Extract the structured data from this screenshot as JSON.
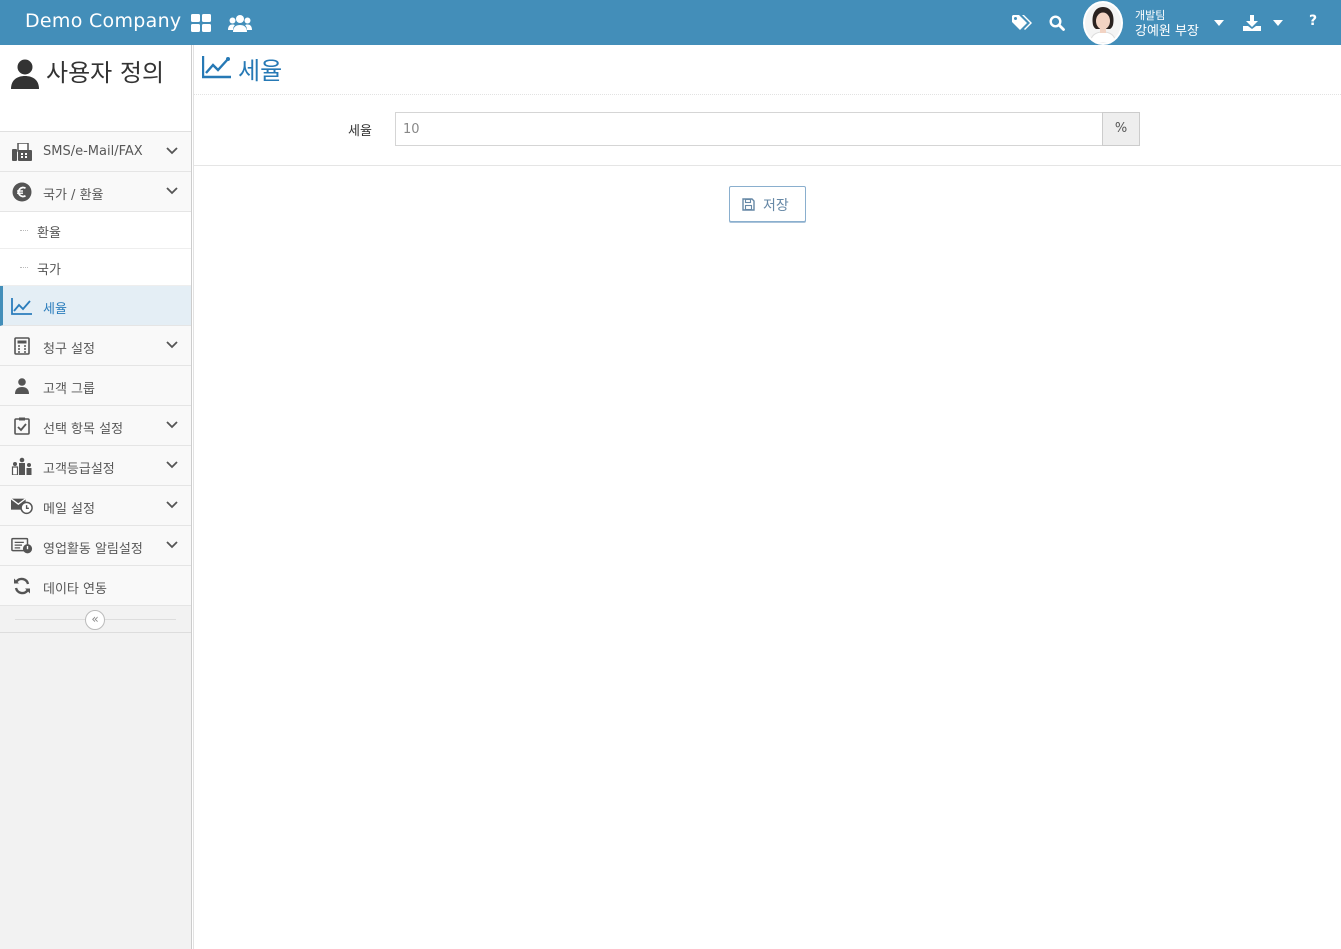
{
  "navbar": {
    "brand": "Demo Company",
    "user_team": "개발팀",
    "user_name": "강예원 부장",
    "help": "?"
  },
  "sidebar": {
    "title": "사용자 정의",
    "items": [
      {
        "label": "SMS/e-Mail/FAX",
        "icon": "fax-icon"
      },
      {
        "label": "국가 / 환율",
        "icon": "euro-icon"
      },
      {
        "label": "세율",
        "icon": "line-chart-icon"
      },
      {
        "label": "청구 설정",
        "icon": "calculator-icon"
      },
      {
        "label": "고객 그룹",
        "icon": "user-icon"
      },
      {
        "label": "선택 항목 설정",
        "icon": "clipboard-check-icon"
      },
      {
        "label": "고객등급설정",
        "icon": "ranking-icon"
      },
      {
        "label": "메일 설정",
        "icon": "mail-clock-icon"
      },
      {
        "label": "영업활동 알림설정",
        "icon": "list-alert-icon"
      },
      {
        "label": "데이타 연동",
        "icon": "refresh-icon"
      }
    ],
    "subitems": [
      "환율",
      "국가"
    ],
    "collapse": "«"
  },
  "main": {
    "page_title": "세율",
    "field_label": "세율",
    "field_value": "10",
    "field_addon": "%",
    "save_label": "저장"
  },
  "colors": {
    "navbar": "#438eb9",
    "accent": "#2679b5"
  }
}
